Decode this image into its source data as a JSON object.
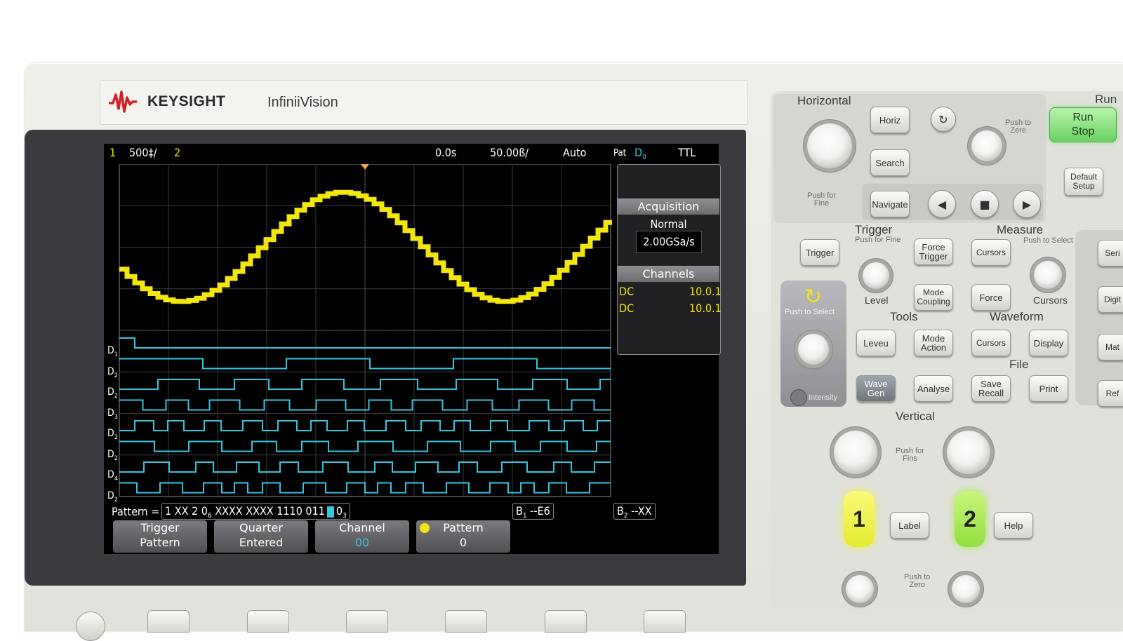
{
  "brand": {
    "name": "KEYSIGHT",
    "model": "InfiniiVision"
  },
  "status_bar": {
    "ch1": "1",
    "ch1_scale": "500‡/",
    "ch2": "2",
    "time_offset": "0.0s",
    "time_scale": "50.00ß/",
    "trigger_mode": "Auto",
    "pat_label": "Pat",
    "pat_channel": "D",
    "pat_channel_sub": "0",
    "threshold": "TTL"
  },
  "side_panel": {
    "acquisition_title": "Acquisition",
    "acquisition_mode": "Normal",
    "sample_rate": "2.00GSa/s",
    "channels_title": "Channels",
    "channels": [
      {
        "coupling": "DC",
        "value": "10.0.1"
      },
      {
        "coupling": "DC",
        "value": "10.0.1"
      }
    ]
  },
  "digital_labels": [
    {
      "main": "D",
      "sub": "1"
    },
    {
      "main": "D",
      "sub": "2"
    },
    {
      "main": "D",
      "sub": "2"
    },
    {
      "main": "D",
      "sub": "3"
    },
    {
      "main": "D",
      "sub": "2"
    },
    {
      "main": "D",
      "sub": "2"
    },
    {
      "main": "D",
      "sub": "4"
    },
    {
      "main": "D",
      "sub": "2"
    }
  ],
  "pattern_line": {
    "label": "Pattern =",
    "value": "1 XX 2 0",
    "value_sub": "6",
    "value2": " XXXX XXXX 1110 011",
    "value_end": "0",
    "value_end_sub": "3",
    "b1": "B",
    "b1_sub": "1",
    "b1_val": " --E6",
    "b2": "B",
    "b2_sub": "2",
    "b2_val": " --XX"
  },
  "softkeys": [
    {
      "line1": "Trigger",
      "line2": "Pattern"
    },
    {
      "line1": "Quarter",
      "line2": "Entered"
    },
    {
      "line1": "Channel",
      "line2": "00"
    },
    {
      "line1": "Pattern",
      "line2": "0"
    }
  ],
  "horizontal": {
    "title": "Horizontal",
    "horiz": "Horiz",
    "search": "Search",
    "navigate": "Navigate",
    "push_fine": "Push for\nFine",
    "push_zero": "Push to\nZere"
  },
  "run": {
    "title": "Run",
    "run_stop_1": "Run",
    "run_stop_2": "Stop",
    "default_1": "Default",
    "default_2": "Setup"
  },
  "trigger": {
    "title": "Trigger",
    "push_fine": "Push for Fine",
    "trigger_btn": "Trigger",
    "force_1": "Force",
    "force_2": "Trigger",
    "level": "Level",
    "mode_1": "Mode",
    "mode_2": "Coupling"
  },
  "measure": {
    "title": "Measure",
    "push_select": "Push to Select",
    "cursors_btn": "Cursors",
    "force": "Force",
    "cursors_label": "Cursors"
  },
  "intensity": {
    "push_select": "Push to Select",
    "label": "Intensity"
  },
  "tools": {
    "title": "Tools",
    "leveu": "Leveu",
    "mode_1": "Mode",
    "mode_2": "Action",
    "wave_1": "Wave",
    "wave_2": "Gen",
    "analyse": "Analyse"
  },
  "waveform": {
    "title": "Waveform",
    "cursors": "Cursors",
    "display": "Display"
  },
  "file": {
    "title": "File",
    "save_1": "Save",
    "save_2": "Recall",
    "print": "Print"
  },
  "vertical": {
    "title": "Vertical",
    "push_fins": "Push for\nFins",
    "ch1": "1",
    "label": "Label",
    "ch2": "2",
    "help": "Help",
    "push_zero": "Push to\nZero"
  },
  "right_edge": {
    "serial": "Seri",
    "digital": "Digit",
    "math": "Mat",
    "ref": "Ref"
  },
  "colors": {
    "ch1": "#f2e60c",
    "digital": "#35c6e0",
    "run": "#7fe07a",
    "ch2_key": "#a6e85a"
  }
}
